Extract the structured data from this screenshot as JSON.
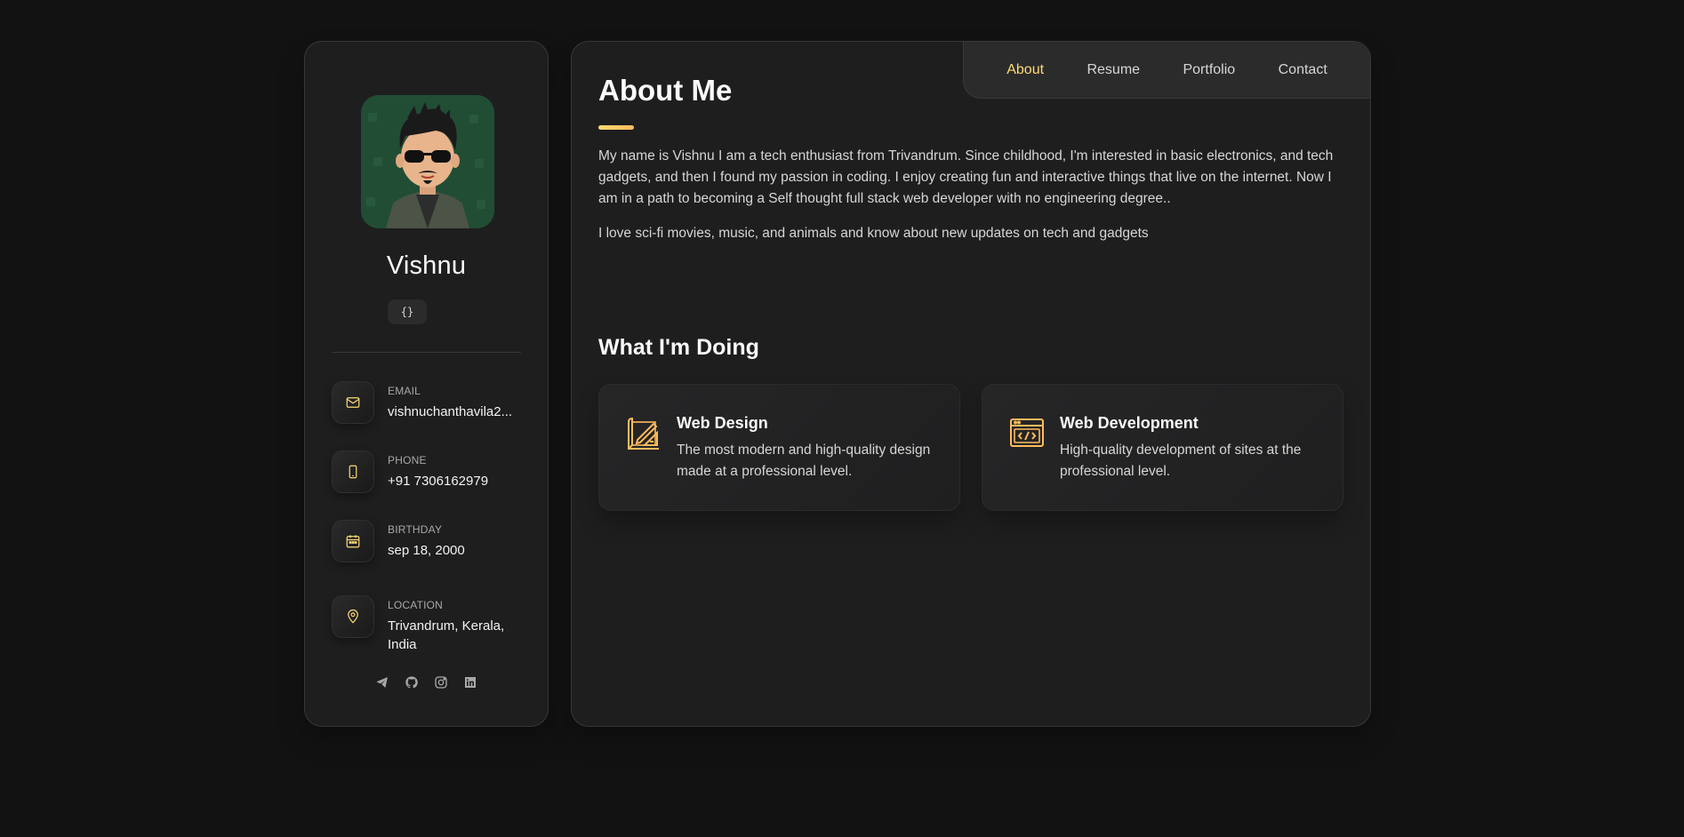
{
  "profile": {
    "name": "Vishnu",
    "title_badge": "{}",
    "avatar_icon": "memoji-avatar"
  },
  "contacts": [
    {
      "icon": "mail-icon",
      "title": "EMAIL",
      "value": "vishnuchanthavila2..."
    },
    {
      "icon": "phone-icon",
      "title": "PHONE",
      "value": "+91 7306162979"
    },
    {
      "icon": "calendar-icon",
      "title": "BIRTHDAY",
      "value": "sep 18, 2000"
    },
    {
      "icon": "location-pin-icon",
      "title": "LOCATION",
      "value": "Trivandrum, Kerala, India"
    }
  ],
  "socials": [
    "telegram-icon",
    "github-icon",
    "instagram-icon",
    "linkedin-icon"
  ],
  "navbar": {
    "items": [
      "About",
      "Resume",
      "Portfolio",
      "Contact"
    ],
    "active": "About"
  },
  "about": {
    "title": "About Me",
    "paragraphs": [
      "My name is Vishnu I am a tech enthusiast from Trivandrum. Since childhood, I'm interested in basic electronics, and tech gadgets, and then I found my passion in coding. I enjoy creating fun and interactive things that live on the internet. Now I am in a path to becoming a Self thought full stack web developer with no engineering degree..",
      "I love sci-fi movies, music, and animals and know about new updates on tech and gadgets"
    ]
  },
  "services": {
    "title": "What I'm Doing",
    "items": [
      {
        "icon": "design-icon",
        "title": "Web Design",
        "text": "The most modern and high-quality design made at a professional level."
      },
      {
        "icon": "code-window-icon",
        "title": "Web Development",
        "text": "High-quality development of sites at the professional level."
      }
    ]
  },
  "colors": {
    "accent": "#ffdb70",
    "background": "#121212",
    "panel": "#1e1e1f",
    "border": "#383838"
  }
}
